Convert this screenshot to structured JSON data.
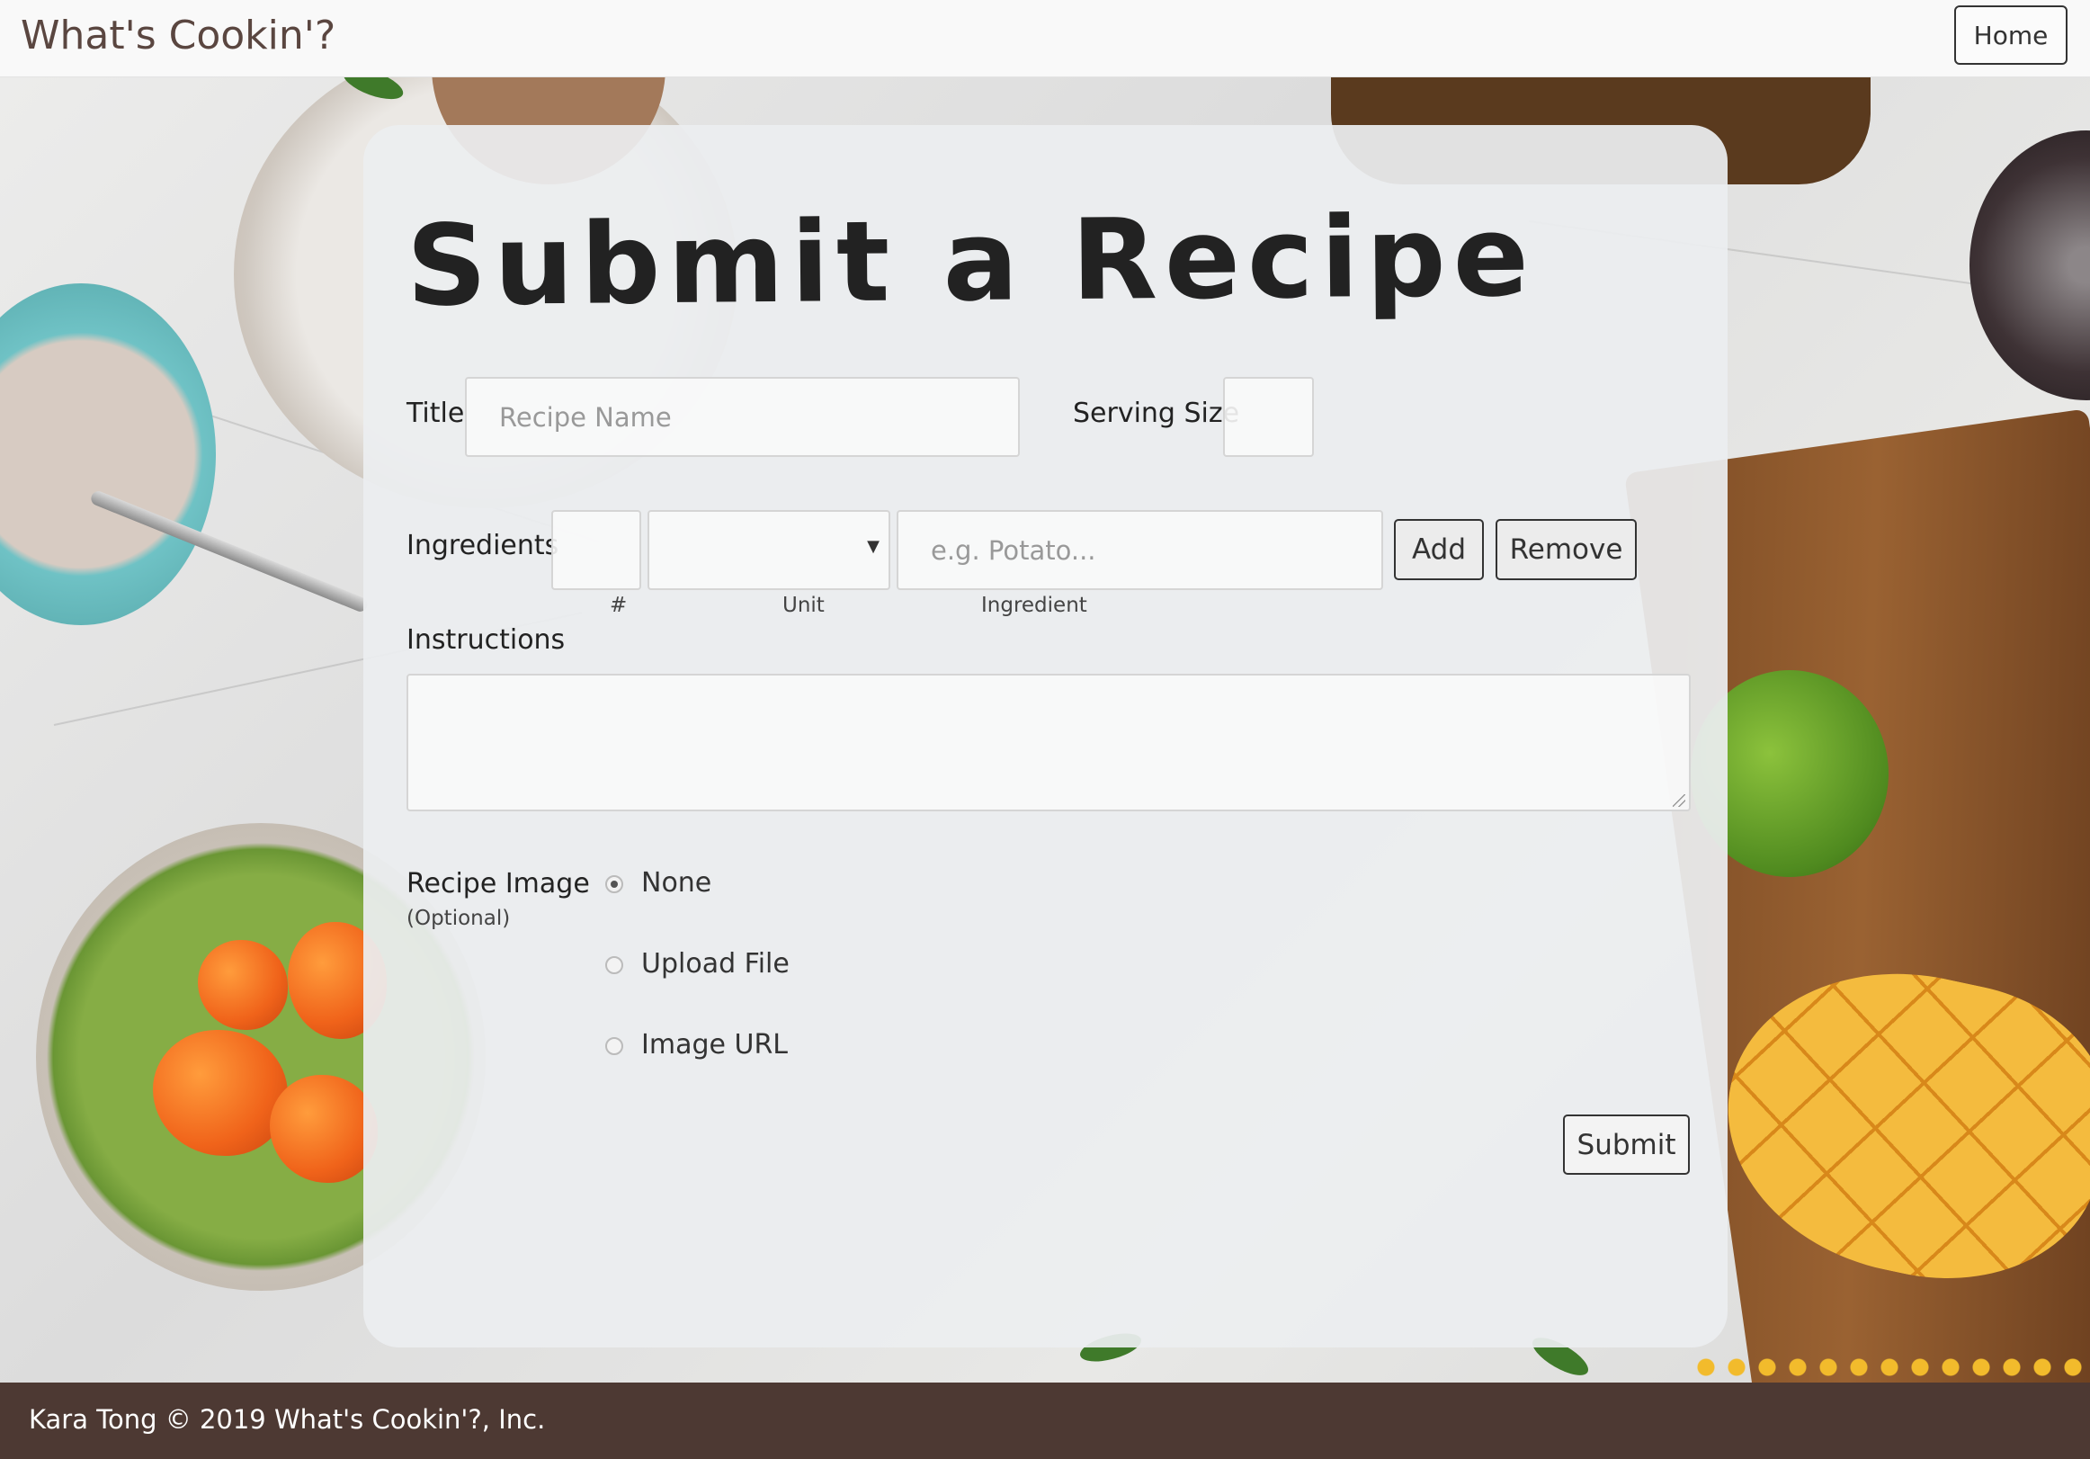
{
  "header": {
    "brand": "What's Cookin'?",
    "home_label": "Home"
  },
  "form": {
    "heading": "Submit a Recipe",
    "title_label": "Title",
    "title_placeholder": "Recipe Name",
    "title_value": "",
    "serving_size_label": "Serving Size",
    "serving_size_value": "",
    "ingredients_label": "Ingredients",
    "ingredient_row": {
      "quantity_value": "",
      "unit_value": "",
      "ingredient_placeholder": "e.g. Potato...",
      "quantity_caption": "#",
      "unit_caption": "Unit",
      "ingredient_caption": "Ingredient"
    },
    "add_label": "Add",
    "remove_label": "Remove",
    "instructions_label": "Instructions",
    "instructions_value": "",
    "image_label": "Recipe Image",
    "image_optional": "(Optional)",
    "image_options": [
      {
        "label": "None",
        "checked": true
      },
      {
        "label": "Upload File",
        "checked": false
      },
      {
        "label": "Image URL",
        "checked": false
      }
    ],
    "submit_label": "Submit"
  },
  "footer": {
    "text": "Kara Tong © 2019 What's Cookin'?, Inc."
  },
  "colors": {
    "footer_bg": "#4d3933",
    "brand_text": "#5a4640",
    "card_bg": "#eceef0"
  }
}
